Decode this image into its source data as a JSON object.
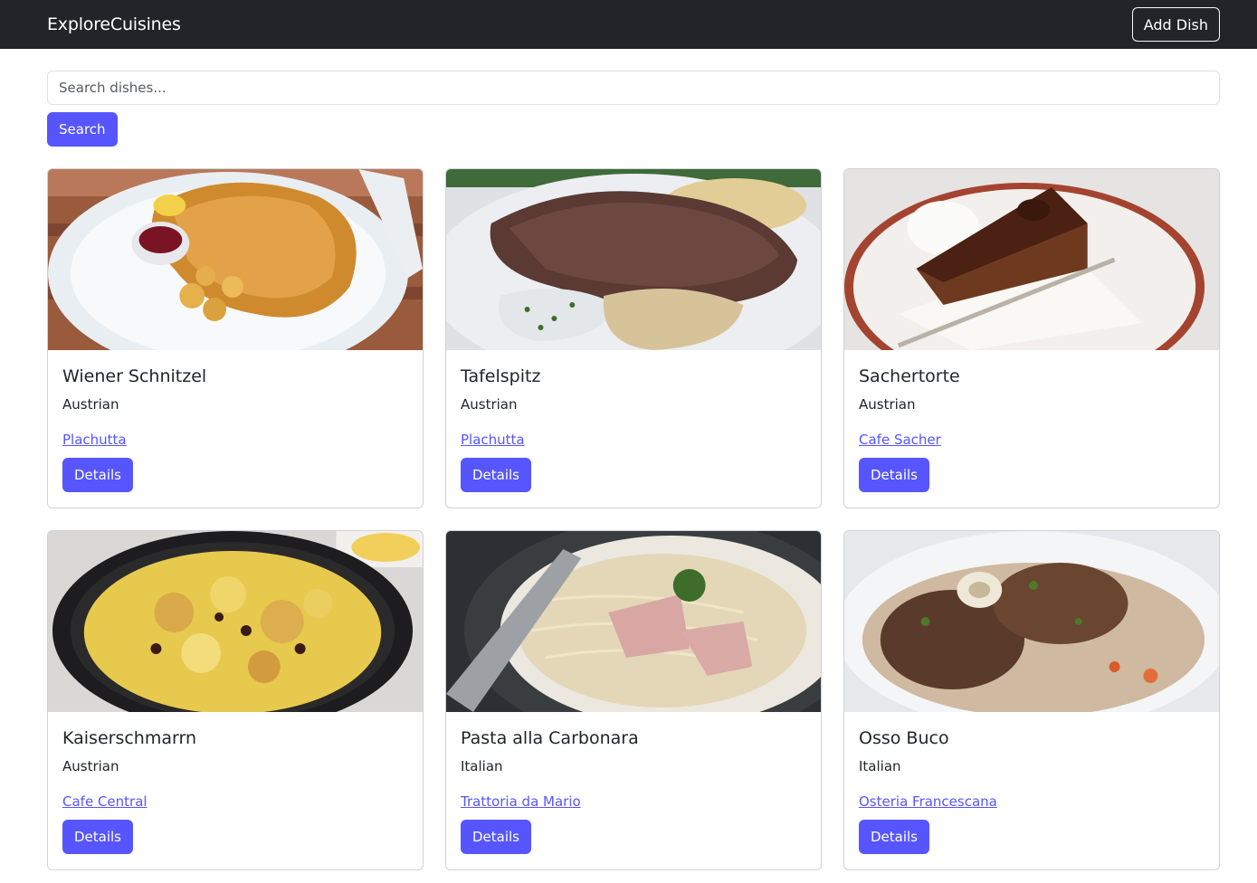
{
  "navbar": {
    "brand": "ExploreCuisines",
    "add_dish_label": "Add Dish"
  },
  "search": {
    "placeholder": "Search dishes...",
    "value": "",
    "button_label": "Search"
  },
  "dishes": [
    {
      "name": "Wiener Schnitzel",
      "cuisine": "Austrian",
      "restaurant": "Plachutta",
      "details_label": "Details",
      "image": "schnitzel-photo"
    },
    {
      "name": "Tafelspitz",
      "cuisine": "Austrian",
      "restaurant": "Plachutta",
      "details_label": "Details",
      "image": "tafelspitz-photo"
    },
    {
      "name": "Sachertorte",
      "cuisine": "Austrian",
      "restaurant": "Cafe Sacher",
      "details_label": "Details",
      "image": "sachertorte-photo"
    },
    {
      "name": "Kaiserschmarrn",
      "cuisine": "Austrian",
      "restaurant": "Cafe Central",
      "details_label": "Details",
      "image": "kaiserschmarrn-photo"
    },
    {
      "name": "Pasta alla Carbonara",
      "cuisine": "Italian",
      "restaurant": "Trattoria da Mario",
      "details_label": "Details",
      "image": "carbonara-photo"
    },
    {
      "name": "Osso Buco",
      "cuisine": "Italian",
      "restaurant": "Osteria Francescana",
      "details_label": "Details",
      "image": "osso-buco-photo"
    }
  ],
  "colors": {
    "navbar_bg": "#212529",
    "primary": "#5655ff",
    "link": "#5655ff"
  }
}
